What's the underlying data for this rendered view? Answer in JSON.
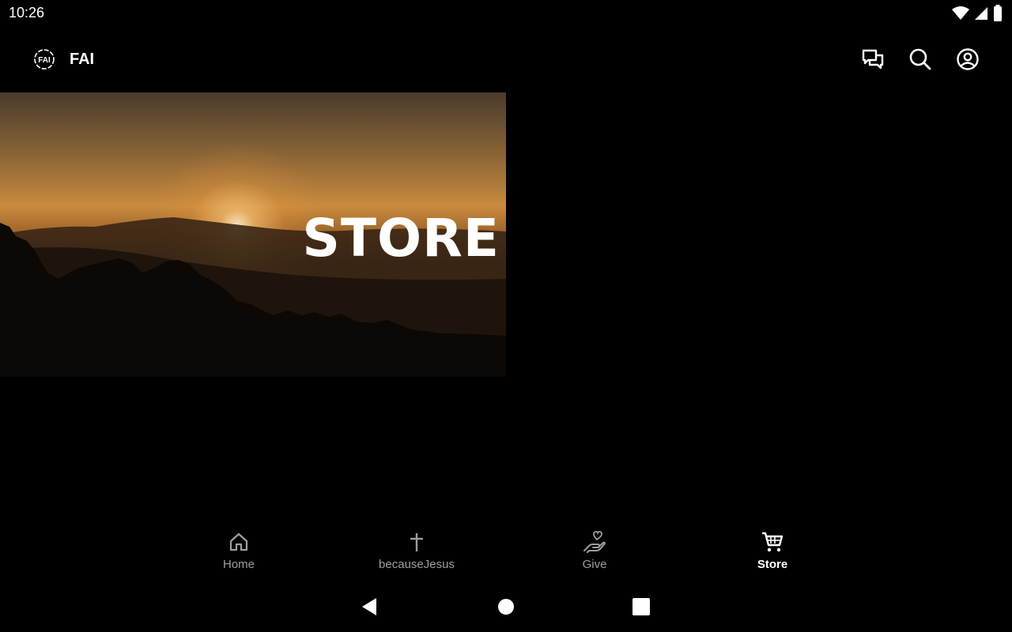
{
  "status_bar": {
    "time": "10:26",
    "icons": [
      "wifi-icon",
      "cellular-signal-icon",
      "battery-icon"
    ]
  },
  "app_bar": {
    "logo_text": "FAI",
    "title": "FAI",
    "actions": [
      "chat-icon",
      "search-icon",
      "account-icon"
    ]
  },
  "banner": {
    "title": "STORE"
  },
  "bottom_nav": {
    "items": [
      {
        "label": "Home",
        "icon": "home-icon",
        "active": false
      },
      {
        "label": "becauseJesus",
        "icon": "cross-icon",
        "active": false
      },
      {
        "label": "Give",
        "icon": "give-hand-heart-icon",
        "active": false
      },
      {
        "label": "Store",
        "icon": "cart-icon",
        "active": true
      }
    ]
  },
  "system_nav": [
    "back-icon",
    "home-circle-icon",
    "recents-square-icon"
  ],
  "colors": {
    "background": "#000000",
    "text": "#ffffff",
    "inactive": "#9e9e9e"
  }
}
